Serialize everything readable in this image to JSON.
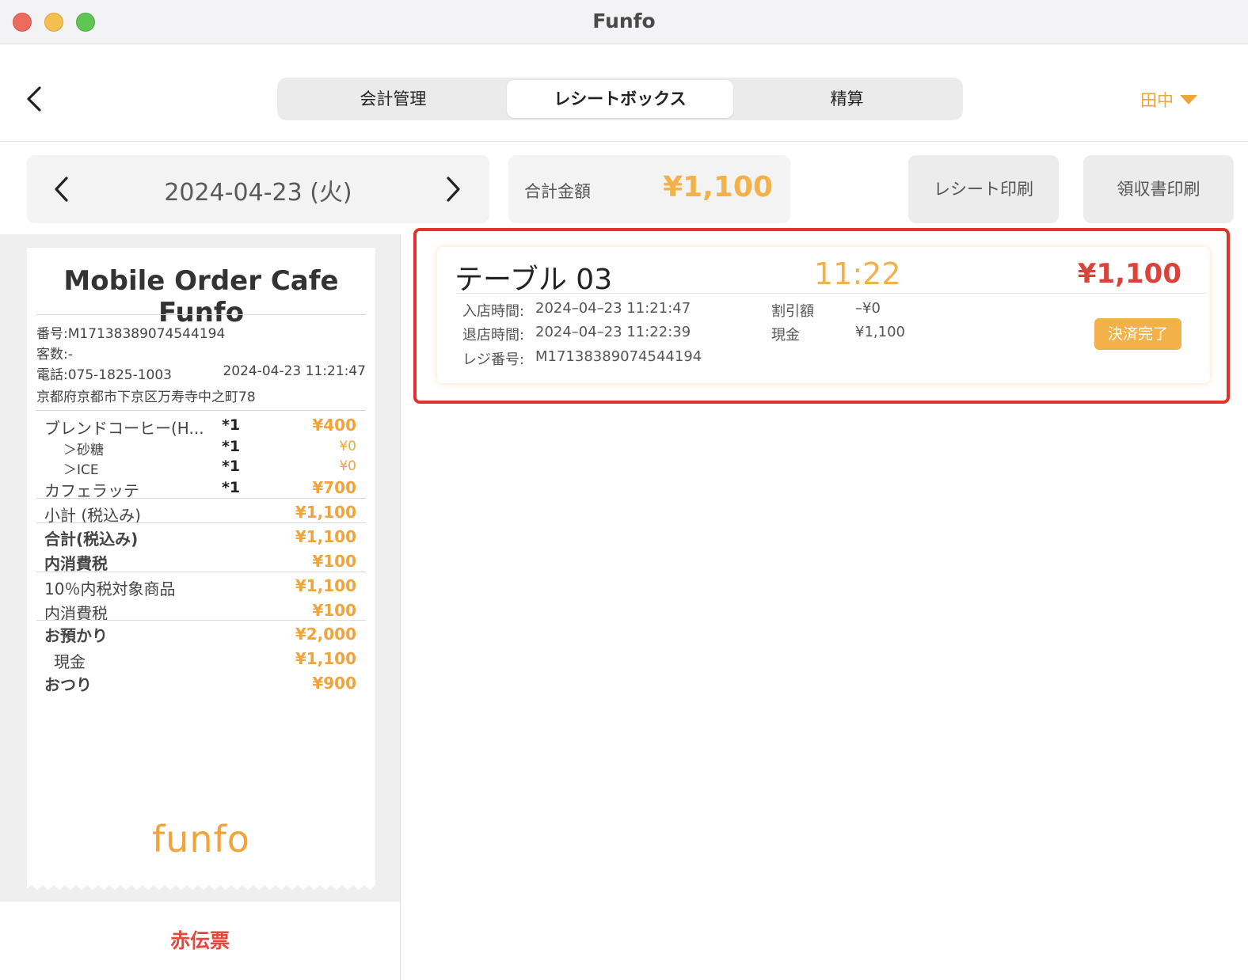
{
  "window": {
    "title": "Funfo"
  },
  "header": {
    "tabs": [
      {
        "label": "会計管理",
        "active": false
      },
      {
        "label": "レシートボックス",
        "active": true
      },
      {
        "label": "精算",
        "active": false
      }
    ],
    "user": "田中"
  },
  "toolbar": {
    "date": "2024-04-23 (火)",
    "total_label": "合計金額",
    "total_value": "¥1,100",
    "receipt_print": "レシート印刷",
    "ryoshu_print": "領収書印刷"
  },
  "receipt": {
    "shop_name": "Mobile Order Cafe Funfo",
    "number": "番号:M17138389074544194",
    "guests": "客数:-",
    "phone": "電話:075-1825-1003",
    "datetime": "2024-04-23 11:21:47",
    "address": "京都府京都市下京区万寿寺中之町78",
    "items": [
      {
        "name": "ブレンドコーヒー(H...",
        "qty": "*1",
        "price": "¥400"
      },
      {
        "name": "＞砂糖",
        "qty": "*1",
        "price": "¥0"
      },
      {
        "name": "＞ICE",
        "qty": "*1",
        "price": "¥0"
      },
      {
        "name": "カフェラッテ",
        "qty": "*1",
        "price": "¥700"
      }
    ],
    "subtotal_label": "小計 (税込み)",
    "subtotal_value": "¥1,100",
    "total_label": "合計(税込み)",
    "total_value": "¥1,100",
    "tax_label": "内消費税",
    "tax_value": "¥100",
    "taxable_label": "10％内税対象商品",
    "taxable_value": "¥1,100",
    "tax2_label": "内消費税",
    "tax2_value": "¥100",
    "deposit_label": "お預かり",
    "deposit_value": "¥2,000",
    "cash_label": "現金",
    "cash_value": "¥1,100",
    "change_label": "おつり",
    "change_value": "¥900",
    "logo_text": "funfo"
  },
  "red_slip": "赤伝票",
  "card": {
    "title": "テーブル 03",
    "time": "11:22",
    "amount": "¥1,100",
    "entry_label": "入店時間:",
    "entry_value": "2024–04–23 11:21:47",
    "exit_label": "退店時間:",
    "exit_value": "2024–04–23 11:22:39",
    "register_label": "レジ番号:",
    "register_value": "M17138389074544194",
    "discount_label": "割引額",
    "discount_value": "–¥0",
    "cash_label": "現金",
    "cash_value": "¥1,100",
    "status": "決済完了"
  },
  "colors": {
    "accent": "#f3b14a",
    "amount_red": "#d9433a",
    "highlight_red": "#e0332b",
    "slip_red": "#e2483e"
  },
  "icons": [
    "chevron-left-icon",
    "chevron-right-icon",
    "caret-down-icon"
  ]
}
